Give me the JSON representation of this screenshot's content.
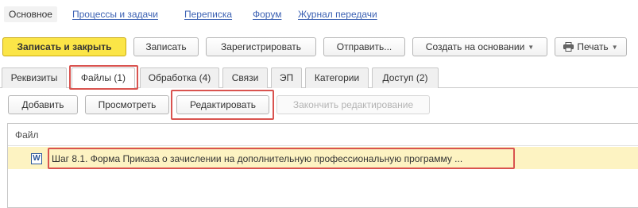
{
  "nav": {
    "items": [
      {
        "label": "Основное",
        "active": true
      },
      {
        "label": "Процессы и задачи"
      },
      {
        "label": "Переписка"
      },
      {
        "label": "Форум"
      },
      {
        "label": "Журнал передачи"
      }
    ]
  },
  "toolbar": {
    "save_close": "Записать и закрыть",
    "save": "Записать",
    "register": "Зарегистрировать",
    "send": "Отправить...",
    "create_based": "Создать на основании",
    "print": "Печать"
  },
  "tabs": [
    {
      "label": "Реквизиты"
    },
    {
      "label": "Файлы (1)",
      "active": true
    },
    {
      "label": "Обработка (4)"
    },
    {
      "label": "Связи"
    },
    {
      "label": "ЭП"
    },
    {
      "label": "Категории"
    },
    {
      "label": "Доступ (2)"
    }
  ],
  "files_toolbar": {
    "add": "Добавить",
    "view": "Просмотреть",
    "edit": "Редактировать",
    "finish_edit": "Закончить редактирование"
  },
  "table": {
    "column": "Файл",
    "rows": [
      {
        "icon": "word-icon",
        "name": "Шаг 8.1. Форма Приказа о зачислении на дополнительную профессиональную программу ..."
      }
    ]
  },
  "colors": {
    "accent": "#fbe547",
    "highlight": "#d9534f",
    "selected_row": "#fdf3c2",
    "link": "#3d62b3"
  }
}
